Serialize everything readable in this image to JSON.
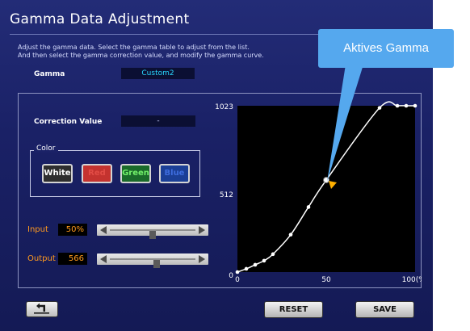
{
  "title": "Gamma Data Adjustment",
  "instructions": [
    "Adjust the gamma data. Select the gamma table to adjust from the list.",
    "And then select the gamma correction value, and modify the gamma curve."
  ],
  "gamma": {
    "label": "Gamma",
    "value": "Custom2"
  },
  "correction": {
    "label": "Correction Value",
    "value": "-"
  },
  "color_group": {
    "legend": "Color",
    "buttons": [
      "White",
      "Red",
      "Green",
      "Blue"
    ],
    "selected": "White"
  },
  "input": {
    "label": "Input",
    "value": "50%",
    "level": 0.5
  },
  "output": {
    "label": "Output",
    "value": "566",
    "level": 0.55
  },
  "chart_data": {
    "type": "line",
    "x": [
      0,
      5,
      10,
      15,
      20,
      30,
      40,
      50,
      80,
      90,
      95,
      100
    ],
    "y": [
      0,
      20,
      45,
      70,
      110,
      230,
      400,
      566,
      1010,
      1023,
      1023,
      1023
    ],
    "x_ticks": [
      "0",
      "50",
      "100(%)"
    ],
    "y_ticks": [
      "0",
      "512",
      "1023"
    ],
    "xlim": [
      0,
      100
    ],
    "ylim": [
      0,
      1023
    ],
    "active_point": {
      "x": 50,
      "y": 566
    },
    "background": "#000000",
    "line_color": "#ffffff",
    "marker_color": "#ffb000"
  },
  "footer": {
    "reset": "RESET",
    "save": "SAVE",
    "back_icon": "return-arrow-icon"
  },
  "callout": {
    "text": "Aktives Gamma",
    "color": "#55a8ee"
  }
}
